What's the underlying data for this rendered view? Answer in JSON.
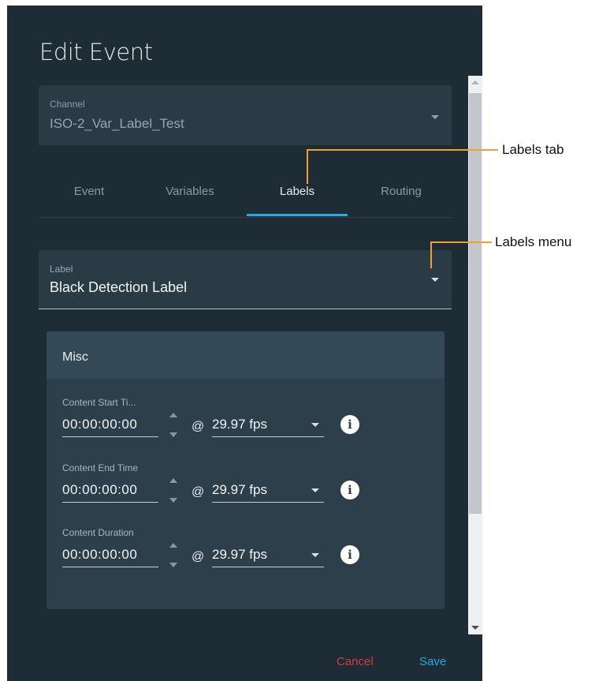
{
  "dialog": {
    "title": "Edit Event",
    "channel": {
      "caption": "Channel",
      "value": "ISO-2_Var_Label_Test"
    },
    "tabs": [
      {
        "label": "Event",
        "active": false
      },
      {
        "label": "Variables",
        "active": false
      },
      {
        "label": "Labels",
        "active": true
      },
      {
        "label": "Routing",
        "active": false
      }
    ],
    "label_select": {
      "caption": "Label",
      "value": "Black Detection Label"
    },
    "misc": {
      "title": "Misc",
      "rows": [
        {
          "label": "Content Start Ti...",
          "time": "00:00:00:00",
          "at": "@",
          "fps": "29.97 fps"
        },
        {
          "label": "Content End Time",
          "time": "00:00:00:00",
          "at": "@",
          "fps": "29.97 fps"
        },
        {
          "label": "Content Duration",
          "time": "00:00:00:00",
          "at": "@",
          "fps": "29.97 fps"
        }
      ]
    },
    "buttons": {
      "cancel": "Cancel",
      "save": "Save"
    }
  },
  "annotations": {
    "labels_tab": "Labels tab",
    "labels_menu": "Labels menu"
  },
  "colors": {
    "dialog_bg": "#1e2c35",
    "accent": "#27a9e1",
    "cancel": "#d63b3b",
    "callout": "#f0a030"
  },
  "icons": [
    "chevron-down-icon",
    "spinner-up-icon",
    "spinner-down-icon",
    "info-icon"
  ]
}
